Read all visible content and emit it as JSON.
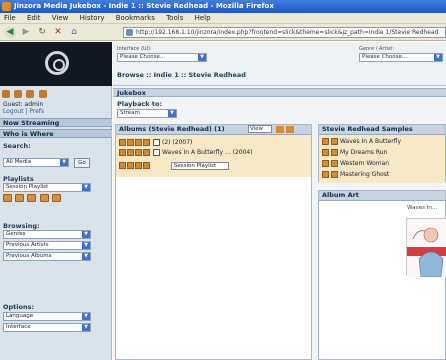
{
  "window": {
    "title": "Jinzora Media Jukebox - Indie 1 :: Stevie Redhead - Mozilla Firefox"
  },
  "menu": [
    "File",
    "Edit",
    "View",
    "History",
    "Bookmarks",
    "Tools",
    "Help"
  ],
  "navbar": {
    "url": "http://192.168.1.10/jinzora/index.php?frontend=slick&theme=slick&jz_path=Indie 1/Stevie Redhead"
  },
  "sidebar": {
    "user": {
      "line1": "Guest: admin",
      "line2": "Logout | Prefs"
    },
    "now_streaming_label": "Now Streaming",
    "who_label": "Who is Where",
    "search_label": "Search:",
    "search_select": "All Media",
    "go_label": "Go",
    "playlists_label": "Playlists",
    "playlist_select": "Session Playlist",
    "browsing_label": "Browsing:",
    "browse_selects": [
      "Genres",
      "Previous Artists",
      "Previous Albums"
    ],
    "options_label": "Options:",
    "options_selects": [
      "Language",
      "Interface"
    ]
  },
  "main": {
    "topbar": {
      "breadcrumb": "Browse :: Indie 1 :: Stevie Redhead",
      "interface_label": "Interface (UI):",
      "interface_value": "Please Choose...",
      "genre_label": "Genre / Artist:",
      "genre_value": "Please Choose..."
    },
    "subbar": "Jukebox",
    "playback_label": "Playback to:",
    "playback_value": "Stream",
    "albums_panel": {
      "title": "Albums (Stevie Redhead) (1)",
      "view_select": "View",
      "rows": [
        "(2) (2007)",
        "Waves In A Butterfly ... (2004)"
      ],
      "playlist_select": "Session Playlist"
    },
    "tracks_panel": {
      "title": "Stevie Redhead Samples",
      "tracks": [
        "Waves In A Butterfly",
        "My Dreams Run",
        "Western Woman",
        "Mastering Ghost"
      ]
    },
    "art_panel": {
      "title": "Album Art",
      "caption": "Waves In..."
    }
  }
}
